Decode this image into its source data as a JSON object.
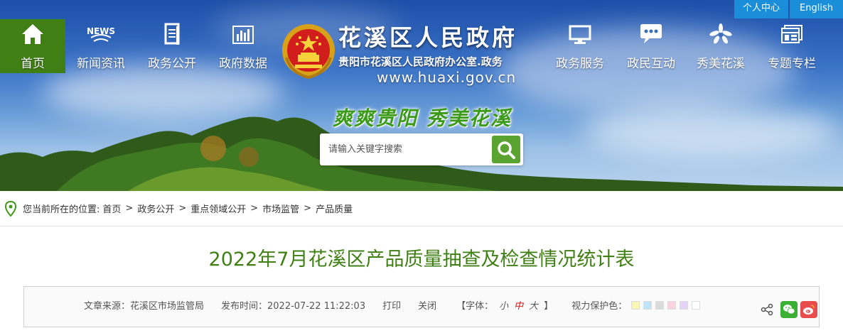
{
  "topbar": {
    "personal_center": "个人中心",
    "english": "English"
  },
  "nav": {
    "home": "首页",
    "news": "新闻资讯",
    "news_badge": "NEWS",
    "gov_open": "政务公开",
    "gov_data": "政府数据",
    "gov_service": "政务服务",
    "interaction": "政民互动",
    "beautiful": "秀美花溪",
    "special": "专题专栏"
  },
  "site": {
    "title": "花溪区人民政府",
    "subtitle": "贵阳市花溪区人民政府办公室.政务",
    "url": "www.huaxi.gov.cn",
    "slogan": "爽爽贵阳  秀美花溪"
  },
  "search": {
    "placeholder": "请输入关键字搜索"
  },
  "breadcrumb": {
    "prefix": "您当前所在的位置:",
    "items": [
      "首页",
      "政务公开",
      "重点领域公开",
      "市场监管",
      "产品质量"
    ],
    "separator": ">"
  },
  "article": {
    "title": "2022年7月花溪区产品质量抽查及检查情况统计表",
    "source": "文章来源：花溪区市场监管局",
    "publish_time": "发布时间：2022-07-22 11:22:03",
    "print": "打印",
    "close": "关闭",
    "font_label": "【字体：",
    "font_small": "小",
    "font_mid": "中",
    "font_large": "大",
    "font_end": "】",
    "eye_label": "视力保护色："
  },
  "colors": {
    "accent_green": "#3f7f14",
    "topbar_blue": "#1a8ed8",
    "swatches": [
      "#fbf7b3",
      "#bfe3f7",
      "#dadada",
      "#fbd3de",
      "#e5d3f7",
      "#ffffff"
    ]
  },
  "icons": {
    "home": "home-icon",
    "news": "news-icon",
    "gov_open": "document-icon",
    "gov_data": "bar-chart-icon",
    "gov_service": "monitor-icon",
    "interaction": "chat-bubble-icon",
    "beautiful": "flower-icon",
    "special": "windows-icon",
    "search": "search-icon",
    "location": "location-pin-icon",
    "share": "share-icon",
    "wechat": "wechat-icon",
    "weibo": "weibo-icon"
  }
}
